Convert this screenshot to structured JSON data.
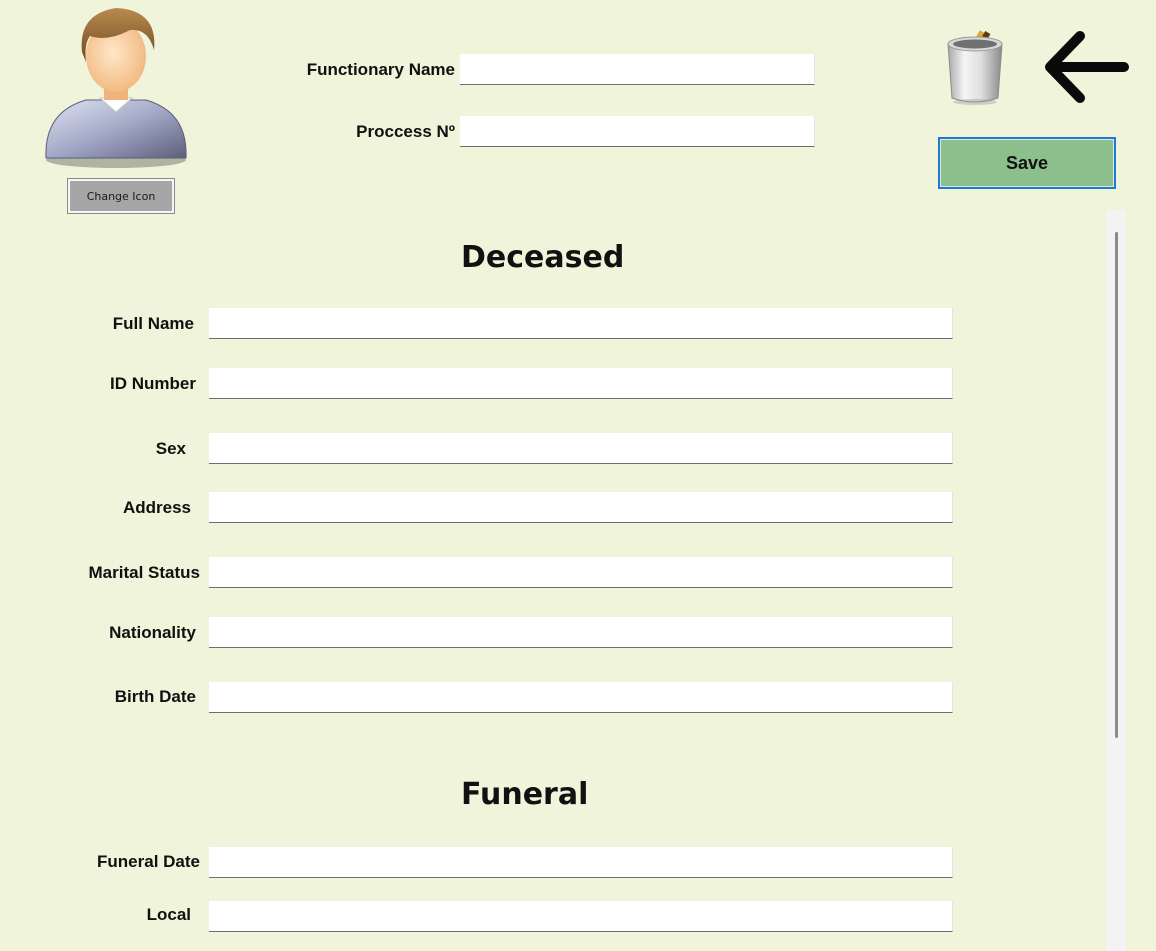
{
  "header": {
    "change_icon_label": "Change Icon",
    "functionary_name_label": "Functionary Name",
    "functionary_name_value": "",
    "process_label": "Proccess Nº",
    "process_value": "",
    "save_label": "Save"
  },
  "icons": {
    "avatar": "user-avatar-icon",
    "delete": "trash-can-icon",
    "back": "arrow-left-icon"
  },
  "deceased": {
    "title": "Deceased",
    "fields": [
      {
        "label": "Full Name",
        "value": ""
      },
      {
        "label": "ID Number",
        "value": ""
      },
      {
        "label": "Sex",
        "value": ""
      },
      {
        "label": "Address",
        "value": ""
      },
      {
        "label": "Marital Status",
        "value": ""
      },
      {
        "label": "Nationality",
        "value": ""
      },
      {
        "label": "Birth Date",
        "value": ""
      }
    ]
  },
  "funeral": {
    "title": "Funeral",
    "fields": [
      {
        "label": "Funeral Date",
        "value": ""
      },
      {
        "label": "Local",
        "value": ""
      }
    ]
  },
  "colors": {
    "background": "#eff4da",
    "save_button": "#8cbf8c",
    "save_border": "#1e78d8",
    "change_icon_button": "#a6a6a6"
  }
}
